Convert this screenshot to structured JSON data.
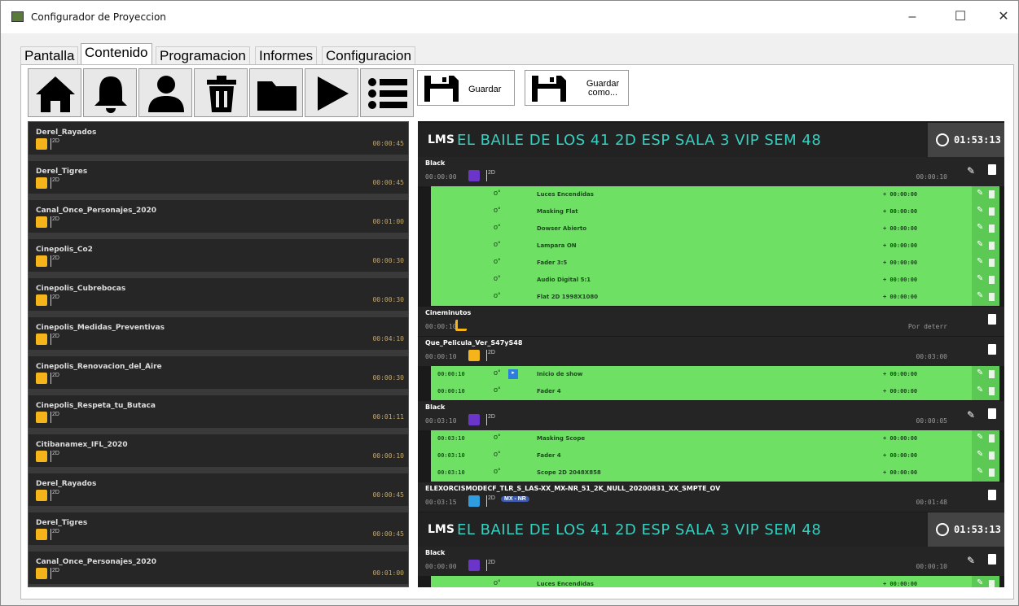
{
  "window": {
    "title": "Configurador de Proyeccion",
    "minimize": "–",
    "maximize": "☐",
    "close": "✕"
  },
  "tabs": [
    {
      "label": "Pantalla"
    },
    {
      "label": "Contenido",
      "active": true
    },
    {
      "label": "Programacion"
    },
    {
      "label": "Informes"
    },
    {
      "label": "Configuracion"
    }
  ],
  "toolbar": {
    "icons": [
      "home-icon",
      "bell-icon",
      "user-icon",
      "trash-icon",
      "folder-icon",
      "play-icon",
      "list-icon"
    ],
    "save_label": "Guardar",
    "save_as_label": "Guardar como..."
  },
  "left_list": [
    {
      "name": "Derel_Rayados",
      "time": "00:00:45"
    },
    {
      "name": "Derel_Tigres",
      "time": "00:00:45"
    },
    {
      "name": "Canal_Once_Personajes_2020",
      "time": "00:01:00"
    },
    {
      "name": "Cinepolis_Co2",
      "time": "00:00:30"
    },
    {
      "name": "Cinepolis_Cubrebocas",
      "time": "00:00:30"
    },
    {
      "name": "Cinepolis_Medidas_Preventivas",
      "time": "00:04:10"
    },
    {
      "name": "Cinepolis_Renovacion_del_Aire",
      "time": "00:00:30"
    },
    {
      "name": "Cinepolis_Respeta_tu_Butaca",
      "time": "00:01:11"
    },
    {
      "name": "Citibanamex_IFL_2020",
      "time": "00:00:10"
    },
    {
      "name": "Derel_Rayados",
      "time": "00:00:45"
    },
    {
      "name": "Derel_Tigres",
      "time": "00:00:45"
    },
    {
      "name": "Canal_Once_Personajes_2020",
      "time": "00:01:00"
    }
  ],
  "playlist": {
    "header": {
      "badge": "LMS",
      "title": "EL BAILE DE LOS 41 2D ESP SALA 3 VIP SEM 48",
      "time": "01:53:13"
    },
    "blocks": [
      {
        "name": "Black",
        "start": "00:00:00",
        "duration": "00:00:10",
        "swatch": "#6a35c8",
        "cues": [
          {
            "name": "Luces Encendidas",
            "offset": "+ 00:00:00"
          },
          {
            "name": "Masking Flat",
            "offset": "+ 00:00:00"
          },
          {
            "name": "Dowser Abierto",
            "offset": "+ 00:00:00"
          },
          {
            "name": "Lampara ON",
            "offset": "+ 00:00:00"
          },
          {
            "name": "Fader 3:5",
            "offset": "+ 00:00:00"
          },
          {
            "name": "Audio Digital 5:1",
            "offset": "+ 00:00:00"
          },
          {
            "name": "Flat 2D 1998X1080",
            "offset": "+ 00:00:00"
          }
        ]
      },
      {
        "name": "Cineminutos",
        "start": "00:00:10",
        "duration": "Por deterr",
        "swatch": "#f5b51a"
      },
      {
        "name": "Que_Pelicula_Ver_S47yS48",
        "start": "00:00:10",
        "duration": "00:03:00",
        "swatch": "#f5b51a",
        "cues": [
          {
            "time": "00:00:10",
            "name": "Inicio de show",
            "offset": "+ 00:00:00"
          },
          {
            "time": "00:00:10",
            "name": "Fader 4",
            "offset": "+ 00:00:00"
          }
        ]
      },
      {
        "name": "Black",
        "start": "00:03:10",
        "duration": "00:00:05",
        "swatch": "#6a35c8",
        "cues": [
          {
            "time": "00:03:10",
            "name": "Masking Scope",
            "offset": "+ 00:00:00"
          },
          {
            "time": "00:03:10",
            "name": "Fader 4",
            "offset": "+ 00:00:00"
          },
          {
            "time": "00:03:10",
            "name": "Scope 2D 2048X858",
            "offset": "+ 00:00:00"
          }
        ]
      },
      {
        "name": "ELEXORCISMODECF_TLR_S_LAS-XX_MX-NR_51_2K_NULL_20200831_XX_SMPTE_OV",
        "start": "00:03:15",
        "duration": "00:01:48",
        "swatch": "#2f9de0",
        "tag": "MX - NR"
      }
    ],
    "header2": {
      "badge": "LMS",
      "title": "EL BAILE DE LOS 41 2D ESP SALA 3 VIP SEM 48",
      "time": "01:53:13"
    },
    "block2": {
      "name": "Black",
      "start": "00:00:00",
      "duration": "00:00:10",
      "swatch": "#6a35c8",
      "cue": {
        "name": "Luces Encendidas",
        "offset": "+ 00:00:00"
      }
    }
  },
  "labels": {
    "badge_2d": "2D"
  }
}
